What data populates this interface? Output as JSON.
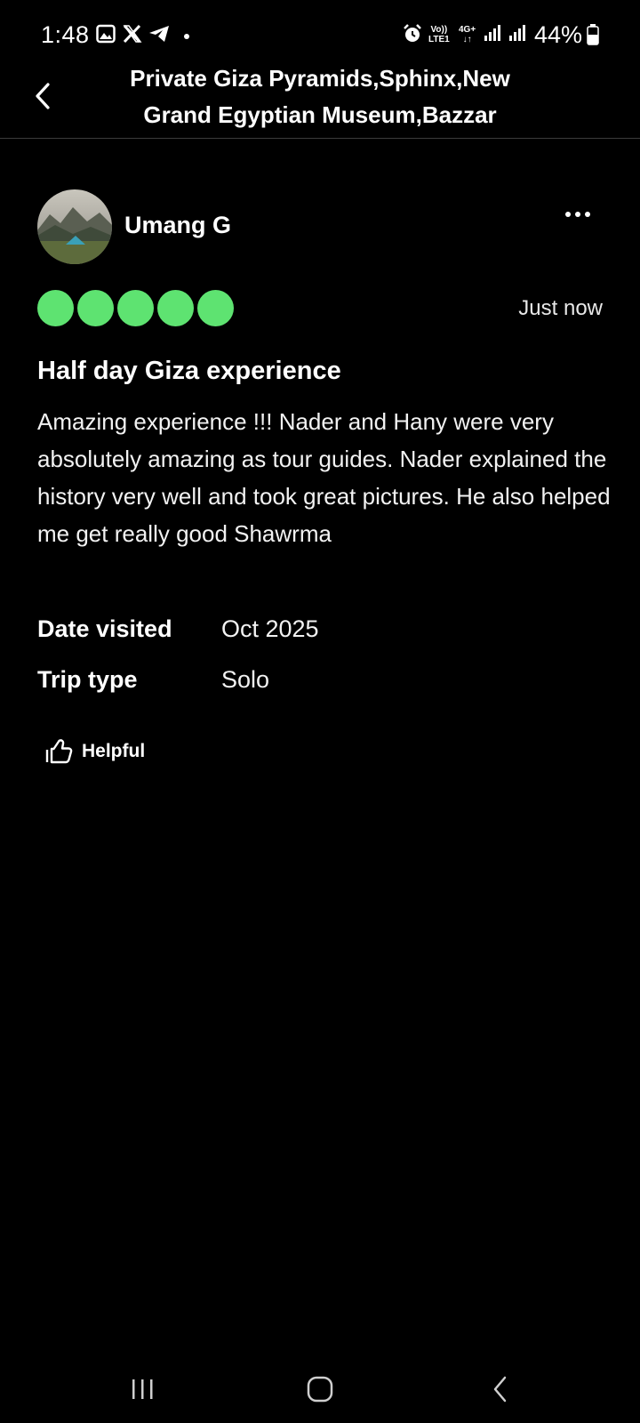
{
  "status_bar": {
    "time": "1:48",
    "notification_icons": [
      "gallery-icon",
      "x-icon",
      "telegram-icon"
    ],
    "network_labels": {
      "volte_top": "Vo))",
      "volte_bottom": "LTE1",
      "data_top": "4G+",
      "data_bottom": "↓↑"
    },
    "battery": "44%"
  },
  "header": {
    "title": "Private Giza Pyramids,Sphinx,New Grand Egyptian Museum,Bazzar"
  },
  "review": {
    "reviewer_name": "Umang G",
    "rating": 5,
    "rating_max": 5,
    "rating_color": "#5ee371",
    "date": "Just now",
    "title": "Half day Giza experience",
    "body": "Amazing experience !!! Nader and Hany were very absolutely amazing as tour guides. Nader explained the history very well and took great pictures. He also helped me get really good Shawrma",
    "details": [
      {
        "label": "Date visited",
        "value": "Oct 2025"
      },
      {
        "label": "Trip type",
        "value": "Solo"
      }
    ],
    "helpful_label": "Helpful"
  },
  "nav_bar": {
    "icons": [
      "recents-icon",
      "home-icon",
      "back-nav-icon"
    ]
  }
}
